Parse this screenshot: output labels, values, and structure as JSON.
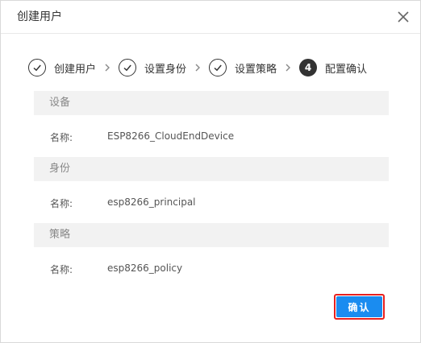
{
  "dialog": {
    "title": "创建用户",
    "close_icon": "close-icon"
  },
  "steps": [
    {
      "label": "创建用户",
      "state": "done",
      "icon": "check-circle-icon"
    },
    {
      "label": "设置身份",
      "state": "done",
      "icon": "check-circle-icon"
    },
    {
      "label": "设置策略",
      "state": "done",
      "icon": "check-circle-icon"
    },
    {
      "number": "4",
      "label": "配置确认",
      "state": "active"
    }
  ],
  "separator_icon": "chevron-right-icon",
  "sections": {
    "device": {
      "header": "设备",
      "name_label": "名称:",
      "name_value": "ESP8266_CloudEndDevice"
    },
    "identity": {
      "header": "身份",
      "name_label": "名称:",
      "name_value": "esp8266_principal"
    },
    "policy": {
      "header": "策略",
      "name_label": "名称:",
      "name_value": "esp8266_policy"
    }
  },
  "confirm_button": {
    "label": "确认"
  },
  "colors": {
    "accent": "#1a8cf0",
    "highlight_border": "#e8211f",
    "section_bg": "#f2f2f2"
  }
}
